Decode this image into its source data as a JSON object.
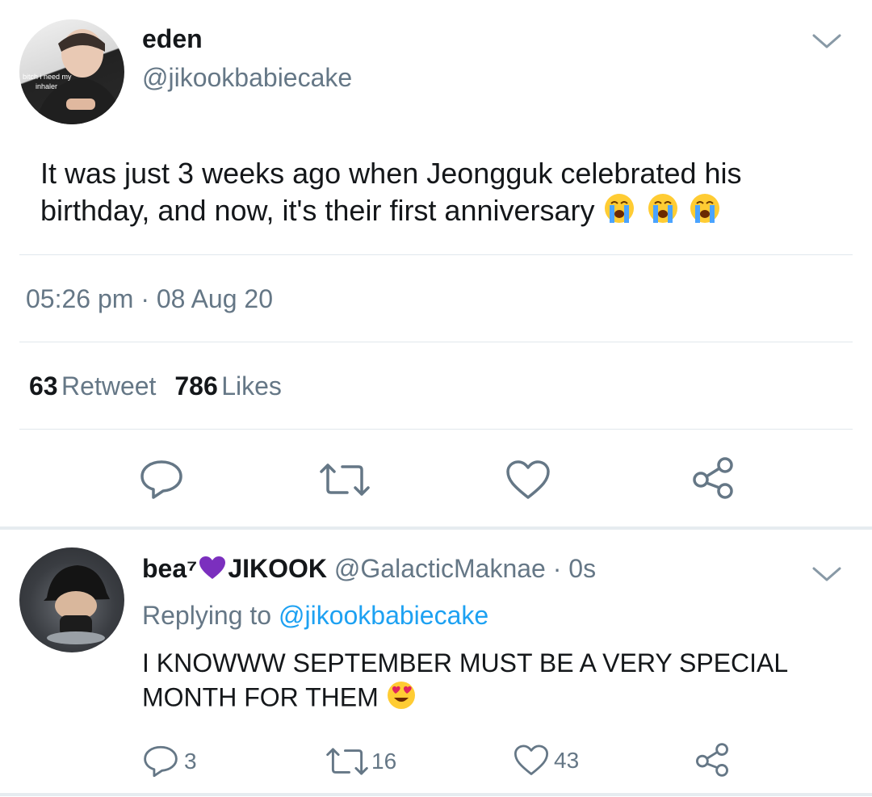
{
  "tweet": {
    "name": "eden",
    "handle": "@jikookbabiecake",
    "avatar_caption": "bitch i need my inhaler",
    "text": "It was just 3 weeks ago when Jeongguk celebrated his birthday, and now, it's their first anniversary",
    "time": "05:26 pm",
    "date": "08 Aug 20",
    "retweets": "63",
    "retweets_label": "Retweet",
    "likes": "786",
    "likes_label": "Likes"
  },
  "reply": {
    "name_prefix": "bea⁷",
    "name_suffix": "JIKOOK",
    "handle": "@GalacticMaknae",
    "time": "0s",
    "replying_label": "Replying to",
    "replying_to": "@jikookbabiecake",
    "text": "I KNOWWW SEPTEMBER MUST BE A VERY SPECIAL MONTH FOR THEM",
    "reply_count": "3",
    "retweet_count": "16",
    "like_count": "43"
  },
  "icons": {
    "reply": "reply-icon",
    "retweet": "retweet-icon",
    "like": "heart-icon",
    "share": "share-icon",
    "caret": "chevron-down-icon"
  },
  "colors": {
    "text": "#14171a",
    "secondary": "#657786",
    "link": "#1da1f2",
    "divider": "#e1e8ed",
    "heart_emoji": "#7b2fbe"
  }
}
